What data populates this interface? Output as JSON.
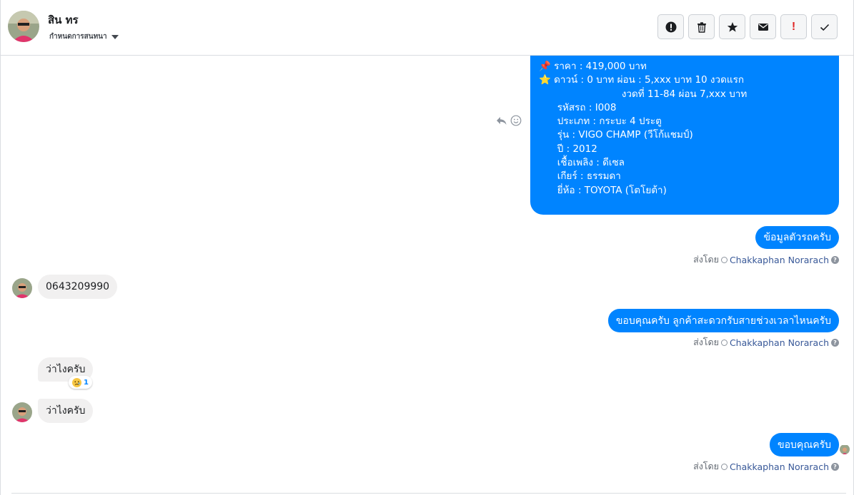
{
  "header": {
    "contact_name": "สิน ทร",
    "label_dropdown": "กำหนดการสนทนา",
    "toolbar": [
      {
        "name": "spam-button",
        "icon": "alert-circle-icon"
      },
      {
        "name": "delete-button",
        "icon": "trash-icon"
      },
      {
        "name": "star-button",
        "icon": "star-icon"
      },
      {
        "name": "mark-unread-button",
        "icon": "envelope-icon"
      },
      {
        "name": "follow-up-button",
        "icon": "red-exclamation-icon"
      },
      {
        "name": "mark-done-button",
        "icon": "check-icon"
      }
    ]
  },
  "messages": {
    "car_details": [
      "📌 ราคา : 419,000 บาท",
      "⭐ ดาวน์ : 0 บาท ผ่อน : 5,xxx บาท 10 งวดแรก",
      "                           งวดที่ 11-84 ผ่อน 7,xxx บาท",
      "",
      "      รหัสรถ : I008",
      "      ประเภท : กระบะ 4 ประตู",
      "      รุ่น : VIGO CHAMP (วีโก้แชมป์)",
      "      ปี : 2012",
      "      เชื้อเพลิง : ดีเซล",
      "      เกียร์ : ธรรมดา",
      "      ยี่ห้อ : TOYOTA (โตโยต้า)"
    ],
    "out_1": "ข้อมูลตัวรถครับ",
    "in_1": "0643209990",
    "out_2": "ขอบคุณครับ ลูกค้าสะดวกรับสายช่วงเวลาไหนครับ",
    "in_2": "ว่าไงครับ",
    "in_2_reaction_count": "1",
    "in_3": "ว่าไงครับ",
    "out_3": "ขอบคุณครับ"
  },
  "sent_by": {
    "prefix": "ส่งโดย",
    "name": "Chakkaphan Norarach"
  },
  "colors": {
    "outgoing_bubble": "#0084ff",
    "incoming_bubble": "#f1f0f0",
    "link_name": "#385898"
  }
}
